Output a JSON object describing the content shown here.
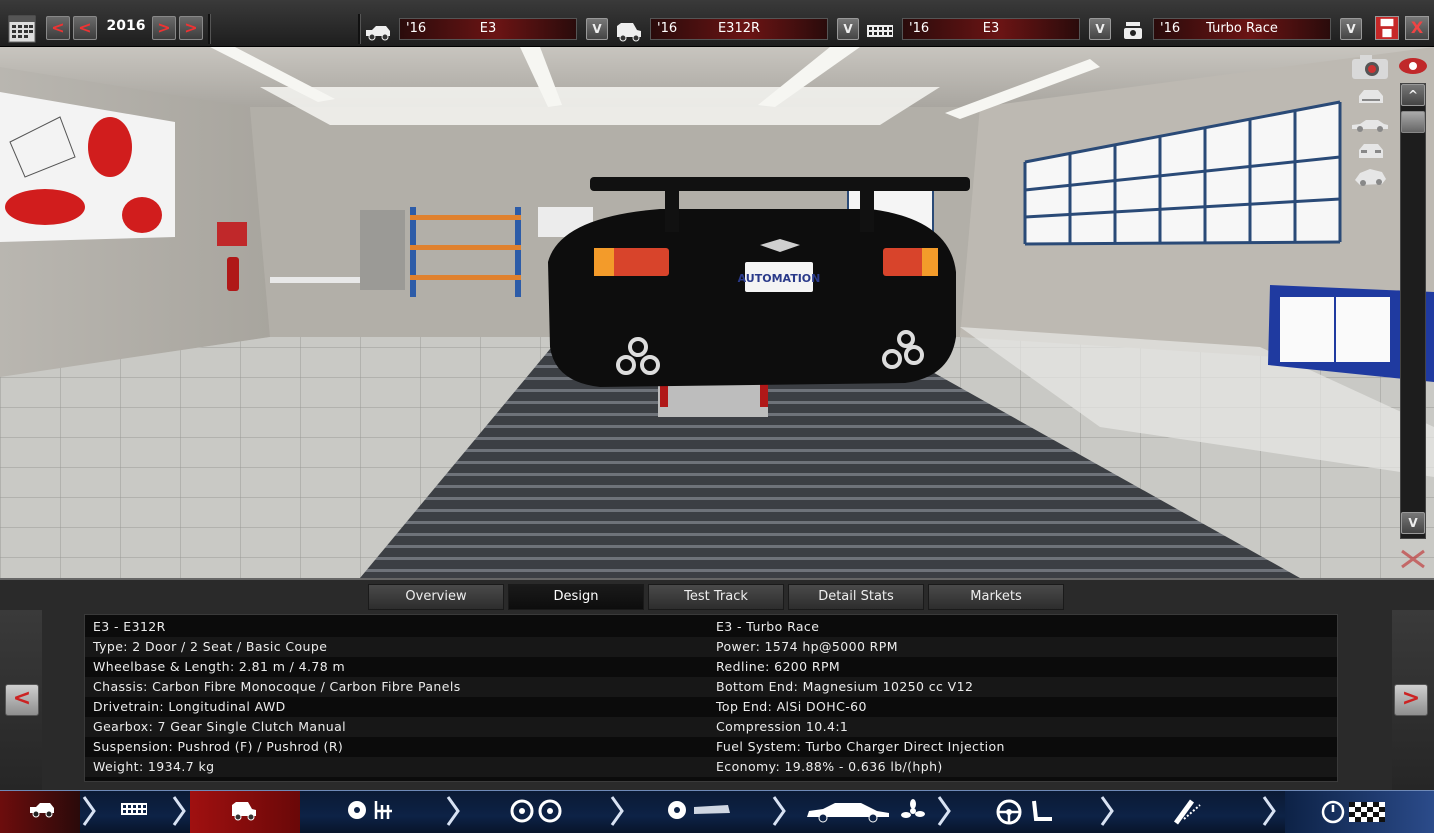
{
  "topbar": {
    "year": "2016",
    "prev_fast": "<",
    "prev": "<",
    "next": ">",
    "next_fast": ">",
    "dropdown_symbol": "V",
    "selectors": [
      {
        "icon": "car-model-icon",
        "year": "'16",
        "name": "E3"
      },
      {
        "icon": "car-trim-icon",
        "year": "'16",
        "name": "E312R"
      },
      {
        "icon": "engine-block-icon",
        "year": "'16",
        "name": "E3"
      },
      {
        "icon": "engine-variant-icon",
        "year": "'16",
        "name": "Turbo Race"
      }
    ],
    "close_label": "X"
  },
  "tabs": [
    {
      "label": "Overview"
    },
    {
      "label": "Design",
      "active": true
    },
    {
      "label": "Test Track"
    },
    {
      "label": "Detail Stats"
    },
    {
      "label": "Markets"
    }
  ],
  "panel": {
    "prev_label": "<",
    "next_label": ">",
    "left": [
      "E3 - E312R",
      "Type: 2 Door / 2 Seat / Basic Coupe",
      "Wheelbase & Length: 2.81 m / 4.78 m",
      "Chassis: Carbon Fibre Monocoque / Carbon Fibre Panels",
      "Drivetrain: Longitudinal AWD",
      "Gearbox: 7 Gear Single Clutch Manual",
      "Suspension: Pushrod (F) / Pushrod (R)",
      "Weight: 1934.7 kg"
    ],
    "right": [
      "E3 - Turbo Race",
      "Power: 1574 hp@5000 RPM",
      "Redline: 6200 RPM",
      "Bottom End: Magnesium 10250 cc V12",
      "Top End: AlSi DOHC-60",
      "Compression 10.4:1",
      "Fuel System: Turbo Charger Direct Injection",
      "Economy: 19.88% - 0.636 lb/(hph)"
    ]
  },
  "viewport": {
    "plate_text": "AUTOMATION"
  },
  "bottomnav": {
    "steps": [
      "car-model-step-icon",
      "chassis-step-icon",
      "trim-step-icon",
      "drivetrain-step-icon",
      "wheels-step-icon",
      "body-aero-step-icon",
      "interior-step-icon",
      "suspension-step-icon",
      "testing-step-icon"
    ],
    "active_index": 2
  },
  "colors": {
    "accent_red": "#c0282a",
    "nav_blue": "#0d2246",
    "active_nav": "#8c1010"
  }
}
